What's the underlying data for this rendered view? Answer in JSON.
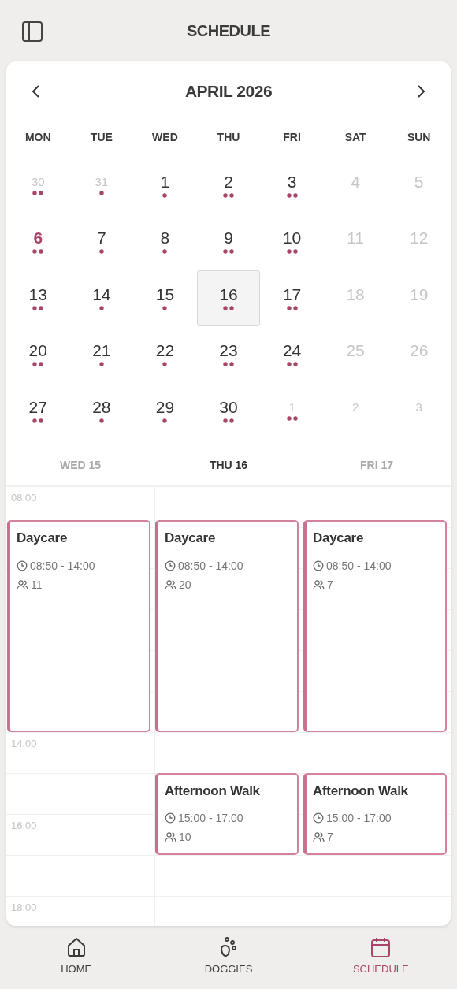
{
  "header": {
    "title": "SCHEDULE"
  },
  "calendar": {
    "month": "APRIL 2026",
    "weekdays": [
      "MON",
      "TUE",
      "WED",
      "THU",
      "FRI",
      "SAT",
      "SUN"
    ],
    "days": [
      {
        "number": "30",
        "muted": true,
        "today": false,
        "selected": false,
        "has_event": true,
        "multiple": true
      },
      {
        "number": "31",
        "muted": true,
        "today": false,
        "selected": false,
        "has_event": true,
        "multiple": false
      },
      {
        "number": "1",
        "muted": false,
        "today": false,
        "selected": false,
        "has_event": true,
        "multiple": false
      },
      {
        "number": "2",
        "muted": false,
        "today": false,
        "selected": false,
        "has_event": true,
        "multiple": true
      },
      {
        "number": "3",
        "muted": false,
        "today": false,
        "selected": false,
        "has_event": true,
        "multiple": true
      },
      {
        "number": "4",
        "muted": true,
        "today": false,
        "selected": false,
        "has_event": false
      },
      {
        "number": "5",
        "muted": true,
        "today": false,
        "selected": false,
        "has_event": false
      },
      {
        "number": "6",
        "muted": false,
        "today": true,
        "selected": false,
        "has_event": true,
        "multiple": true
      },
      {
        "number": "7",
        "muted": false,
        "today": false,
        "selected": false,
        "has_event": true,
        "multiple": false
      },
      {
        "number": "8",
        "muted": false,
        "today": false,
        "selected": false,
        "has_event": true,
        "multiple": false
      },
      {
        "number": "9",
        "muted": false,
        "today": false,
        "selected": false,
        "has_event": true,
        "multiple": true
      },
      {
        "number": "10",
        "muted": false,
        "today": false,
        "selected": false,
        "has_event": true,
        "multiple": true
      },
      {
        "number": "11",
        "muted": true,
        "today": false,
        "selected": false,
        "has_event": false
      },
      {
        "number": "12",
        "muted": true,
        "today": false,
        "selected": false,
        "has_event": false
      },
      {
        "number": "13",
        "muted": false,
        "today": false,
        "selected": false,
        "has_event": true,
        "multiple": true
      },
      {
        "number": "14",
        "muted": false,
        "today": false,
        "selected": false,
        "has_event": true,
        "multiple": false
      },
      {
        "number": "15",
        "muted": false,
        "today": false,
        "selected": false,
        "has_event": true,
        "multiple": false
      },
      {
        "number": "16",
        "muted": false,
        "today": false,
        "selected": true,
        "has_event": true,
        "multiple": true
      },
      {
        "number": "17",
        "muted": false,
        "today": false,
        "selected": false,
        "has_event": true,
        "multiple": true
      },
      {
        "number": "18",
        "muted": true,
        "today": false,
        "selected": false,
        "has_event": false
      },
      {
        "number": "19",
        "muted": true,
        "today": false,
        "selected": false,
        "has_event": false
      },
      {
        "number": "20",
        "muted": false,
        "today": false,
        "selected": false,
        "has_event": true,
        "multiple": true
      },
      {
        "number": "21",
        "muted": false,
        "today": false,
        "selected": false,
        "has_event": true,
        "multiple": false
      },
      {
        "number": "22",
        "muted": false,
        "today": false,
        "selected": false,
        "has_event": true,
        "multiple": false
      },
      {
        "number": "23",
        "muted": false,
        "today": false,
        "selected": false,
        "has_event": true,
        "multiple": true
      },
      {
        "number": "24",
        "muted": false,
        "today": false,
        "selected": false,
        "has_event": true,
        "multiple": true
      },
      {
        "number": "25",
        "muted": true,
        "today": false,
        "selected": false,
        "has_event": false
      },
      {
        "number": "26",
        "muted": true,
        "today": false,
        "selected": false,
        "has_event": false
      },
      {
        "number": "27",
        "muted": false,
        "today": false,
        "selected": false,
        "has_event": true,
        "multiple": true
      },
      {
        "number": "28",
        "muted": false,
        "today": false,
        "selected": false,
        "has_event": true,
        "multiple": false
      },
      {
        "number": "29",
        "muted": false,
        "today": false,
        "selected": false,
        "has_event": true,
        "multiple": false
      },
      {
        "number": "30",
        "muted": false,
        "today": false,
        "selected": false,
        "has_event": true,
        "multiple": true
      },
      {
        "number": "1",
        "muted": true,
        "today": false,
        "selected": false,
        "has_event": true,
        "multiple": true
      },
      {
        "number": "2",
        "muted": true,
        "today": false,
        "selected": false,
        "has_event": false
      },
      {
        "number": "3",
        "muted": true,
        "today": false,
        "selected": false,
        "has_event": false
      }
    ]
  },
  "timeline": {
    "hour_labels": [
      "08:00",
      "14:00",
      "16:00",
      "18:00"
    ],
    "columns": [
      {
        "label": "WED 15",
        "selected": false,
        "events": [
          {
            "title": "Daycare",
            "time": "08:50 - 14:00",
            "count": "11"
          }
        ]
      },
      {
        "label": "THU 16",
        "selected": true,
        "events": [
          {
            "title": "Daycare",
            "time": "08:50 - 14:00",
            "count": "20"
          },
          {
            "title": "Afternoon Walk",
            "time": "15:00 - 17:00",
            "count": "10"
          }
        ]
      },
      {
        "label": "FRI 17",
        "selected": false,
        "events": [
          {
            "title": "Daycare",
            "time": "08:50 - 14:00",
            "count": "7"
          },
          {
            "title": "Afternoon Walk",
            "time": "15:00 - 17:00",
            "count": "7"
          }
        ]
      }
    ]
  },
  "nav": [
    {
      "kind": "home",
      "label": "HOME",
      "selected": false
    },
    {
      "kind": "paw",
      "label": "DOGGIES",
      "selected": false
    },
    {
      "kind": "calendar",
      "label": "SCHEDULE",
      "selected": true
    }
  ]
}
